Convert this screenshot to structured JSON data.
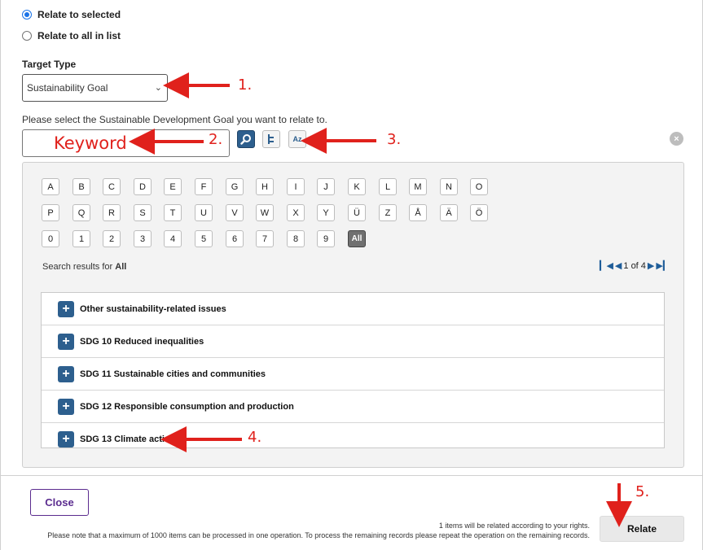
{
  "relate_options": {
    "selected": "Relate to selected",
    "all": "Relate to all in list"
  },
  "target_type": {
    "label": "Target Type",
    "value": "Sustainability Goal"
  },
  "prompt": "Please select the Sustainable Development Goal you want to relate to.",
  "keyword_overlay": "Keyword",
  "toolbar": {
    "search_icon": "magnifier-icon",
    "tree_icon": "hierarchy-icon",
    "sort_icon": "az-sort-icon",
    "az_text": "Az"
  },
  "alphabet": {
    "row1": [
      "A",
      "B",
      "C",
      "D",
      "E",
      "F",
      "G",
      "H",
      "I",
      "J",
      "K",
      "L",
      "M",
      "N",
      "O"
    ],
    "row2": [
      "P",
      "Q",
      "R",
      "S",
      "T",
      "U",
      "V",
      "W",
      "X",
      "Y",
      "Ü",
      "Z",
      "Å",
      "Ä",
      "Ö"
    ],
    "row3": [
      "0",
      "1",
      "2",
      "3",
      "4",
      "5",
      "6",
      "7",
      "8",
      "9",
      "All"
    ]
  },
  "results": {
    "prefix": "Search results for",
    "term": "All",
    "page_text": "1 of 4"
  },
  "items": [
    "Other sustainability-related issues",
    "SDG 10 Reduced inequalities",
    "SDG 11 Sustainable cities and communities",
    "SDG 12 Responsible consumption and production",
    "SDG 13 Climate action"
  ],
  "footer": {
    "close_label": "Close",
    "relate_label": "Relate",
    "note_items": "1 items will be related according to your rights.",
    "note_max": "Please note that a maximum of 1000 items can be processed in one operation. To process the remaining records please repeat the operation on the remaining records."
  },
  "annotations": [
    "1.",
    "2.",
    "3.",
    "4.",
    "5."
  ],
  "colors": {
    "annotation_red": "#e0211c",
    "accent_blue": "#2d5f8e",
    "close_purple": "#5b2c8f"
  }
}
